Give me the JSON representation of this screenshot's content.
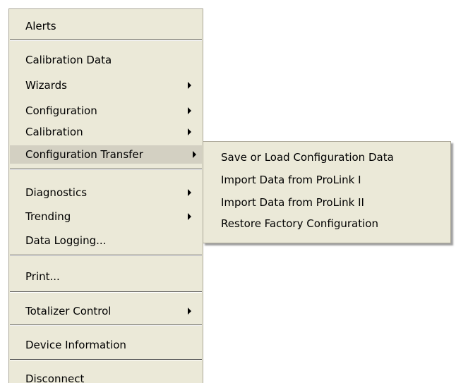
{
  "main_menu": {
    "items": [
      {
        "label": "Alerts",
        "has_submenu": false
      },
      {
        "label": "Calibration Data",
        "has_submenu": false
      },
      {
        "label": "Wizards",
        "has_submenu": true
      },
      {
        "label": "Configuration",
        "has_submenu": true
      },
      {
        "label": "Calibration",
        "has_submenu": true
      },
      {
        "label": "Configuration Transfer",
        "has_submenu": true,
        "highlighted": true
      },
      {
        "label": "Diagnostics",
        "has_submenu": true
      },
      {
        "label": "Trending",
        "has_submenu": true
      },
      {
        "label": "Data Logging...",
        "has_submenu": false
      },
      {
        "label": "Print...",
        "has_submenu": false
      },
      {
        "label": "Totalizer Control",
        "has_submenu": true
      },
      {
        "label": "Device Information",
        "has_submenu": false
      },
      {
        "label": "Disconnect",
        "has_submenu": false
      }
    ]
  },
  "submenu": {
    "items": [
      {
        "label": "Save or Load Configuration Data"
      },
      {
        "label": "Import Data from ProLink I"
      },
      {
        "label": "Import Data from ProLink II"
      },
      {
        "label": "Restore Factory Configuration"
      }
    ]
  },
  "colors": {
    "menu_background": "#ebe9d8",
    "highlight": "#d3d0c2",
    "border": "#aca899"
  }
}
